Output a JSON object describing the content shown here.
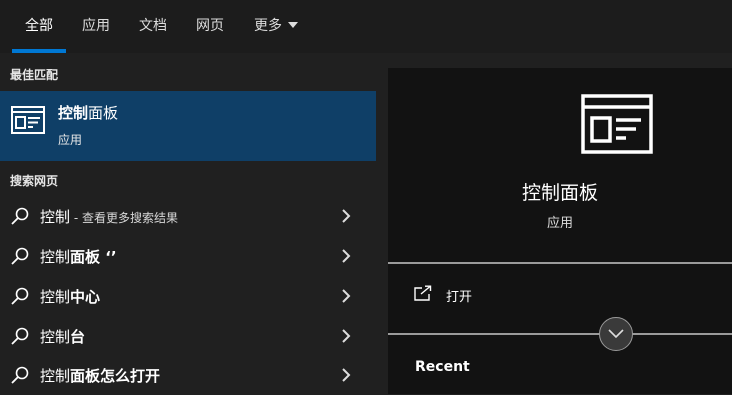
{
  "tabs": [
    {
      "label": "全部"
    },
    {
      "label": "应用"
    },
    {
      "label": "文档"
    },
    {
      "label": "网页"
    },
    {
      "label": "更多"
    }
  ],
  "left": {
    "best_match_label": "最佳匹配",
    "best_match": {
      "title_bold": "控制",
      "title_rest": "面板",
      "subtitle": "应用",
      "icon": "control-panel-icon"
    },
    "web_label": "搜索网页",
    "web_results": [
      {
        "normal": "控制",
        "bold": "",
        "hint": " - 查看更多搜索结果"
      },
      {
        "normal": "控制",
        "bold": "面板 ‘’",
        "hint": ""
      },
      {
        "normal": "控制",
        "bold": "中心",
        "hint": ""
      },
      {
        "normal": "控制",
        "bold": "台",
        "hint": ""
      },
      {
        "normal": "控制",
        "bold": "面板怎么打开",
        "hint": ""
      }
    ]
  },
  "preview": {
    "title": "控制面板",
    "subtitle": "应用",
    "open_label": "打开",
    "recent_label": "Recent",
    "icon": "control-panel-icon"
  },
  "colors": {
    "accent": "#0078d4",
    "selected_bg": "#0f3f67",
    "panel_bg": "#202020",
    "preview_bg": "#121212"
  }
}
